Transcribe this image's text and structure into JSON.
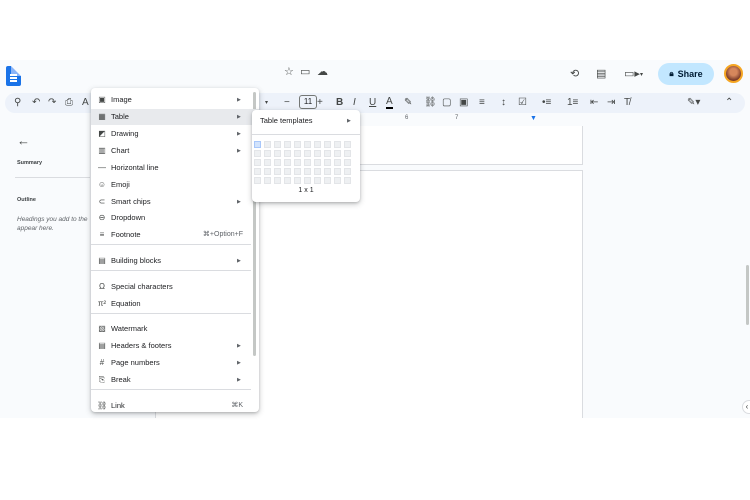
{
  "header": {
    "share_label": "Share",
    "icons": [
      "docs-logo",
      "star-icon",
      "move-folder-icon",
      "cloud-saved-icon",
      "history-icon",
      "comment-icon",
      "video-call-icon",
      "avatar"
    ]
  },
  "toolbar": {
    "font_size": "11",
    "icons": [
      "search-icon",
      "undo-icon",
      "redo-icon",
      "print-icon",
      "spellcheck-icon",
      "bold-icon",
      "italic-icon",
      "underline-icon",
      "text-color-icon",
      "highlight-icon",
      "link-icon",
      "comment-icon",
      "image-icon",
      "align-icon",
      "line-spacing-icon",
      "checklist-icon",
      "bullet-list-icon",
      "numbered-list-icon",
      "decrease-indent-icon",
      "increase-indent-icon",
      "clear-formatting-icon",
      "edit-mode-icon",
      "collapse-icon"
    ]
  },
  "ruler": {
    "marks": [
      "1",
      "2",
      "3",
      "4",
      "5",
      "6",
      "7"
    ]
  },
  "sidebar": {
    "summary_label": "Summary",
    "outline_label": "Outline",
    "outline_hint_line1": "Headings you add to the",
    "outline_hint_line2": "appear here."
  },
  "insert_menu": {
    "items": [
      {
        "label": "Image",
        "icon": "image-icon",
        "submenu": true
      },
      {
        "label": "Table",
        "icon": "table-icon",
        "submenu": true,
        "active": true
      },
      {
        "label": "Drawing",
        "icon": "drawing-icon",
        "submenu": true
      },
      {
        "label": "Chart",
        "icon": "chart-icon",
        "submenu": true
      },
      {
        "label": "Horizontal line",
        "icon": "horizontal-line-icon",
        "submenu": false
      },
      {
        "label": "Emoji",
        "icon": "emoji-icon",
        "submenu": false
      },
      {
        "label": "Smart chips",
        "icon": "smart-chips-icon",
        "submenu": true
      },
      {
        "label": "Dropdown",
        "icon": "dropdown-icon",
        "submenu": false
      },
      {
        "label": "Footnote",
        "icon": "footnote-icon",
        "submenu": false,
        "shortcut": "⌘+Option+F"
      },
      {
        "label": "Building blocks",
        "icon": "building-blocks-icon",
        "submenu": true
      },
      {
        "label": "Special characters",
        "icon": "omega-icon",
        "submenu": false
      },
      {
        "label": "Equation",
        "icon": "pi-icon",
        "submenu": false
      },
      {
        "label": "Watermark",
        "icon": "watermark-icon",
        "submenu": false
      },
      {
        "label": "Headers & footers",
        "icon": "headers-footers-icon",
        "submenu": true
      },
      {
        "label": "Page numbers",
        "icon": "hash-icon",
        "submenu": true
      },
      {
        "label": "Break",
        "icon": "break-icon",
        "submenu": true
      },
      {
        "label": "Link",
        "icon": "link-icon",
        "submenu": false,
        "shortcut": "⌘K"
      }
    ]
  },
  "table_submenu": {
    "templates_label": "Table templates",
    "grid_size_label": "1 x 1",
    "grid": {
      "columns": 10,
      "rows": 5,
      "selected_columns": 1,
      "selected_rows": 1
    }
  },
  "colors": {
    "accent": "#1a73e8",
    "share_bg": "#c2e7ff",
    "toolbar_bg": "#edf2fa",
    "menu_active": "#e8eaed",
    "grid_selected": "#d2e3fc"
  }
}
